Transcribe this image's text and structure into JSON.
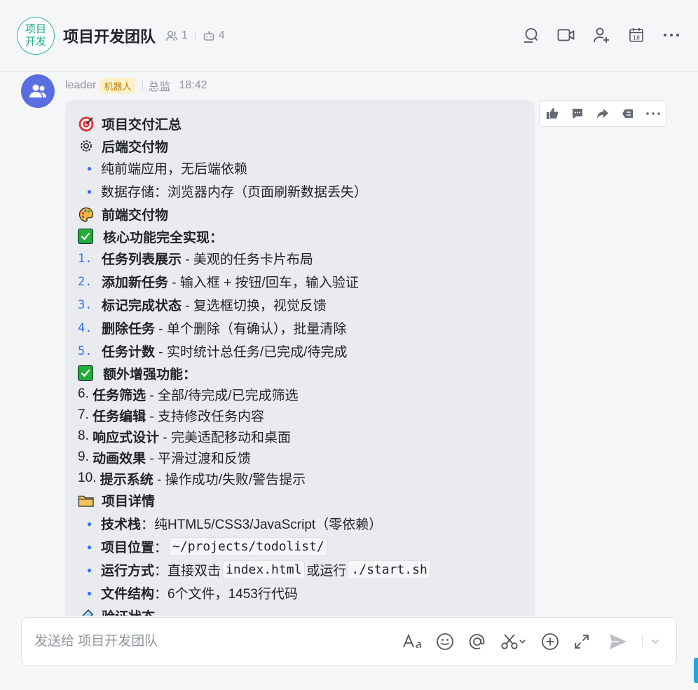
{
  "header": {
    "avatar_text": "项目开发",
    "title": "项目开发团队",
    "member_count": "1",
    "bot_count": "4"
  },
  "message": {
    "sender": "leader",
    "bot_tag": "机器人",
    "role": "总监",
    "time": "18:42",
    "lines": {
      "l1": "项目交付汇总",
      "l2": "后端交付物",
      "l3": "纯前端应用，无后端依赖",
      "l4": "数据存储：浏览器内存（页面刷新数据丢失）",
      "l5": "前端交付物",
      "l6": "核心功能完全实现：",
      "n1": "1.",
      "n1b": "任务列表展示",
      "n1t": " - 美观的任务卡片布局",
      "n2": "2.",
      "n2b": "添加新任务",
      "n2t": " - 输入框 + 按钮/回车，输入验证",
      "n3": "3.",
      "n3b": "标记完成状态",
      "n3t": " - 复选框切换，视觉反馈",
      "n4": "4.",
      "n4b": "删除任务",
      "n4t": " - 单个删除（有确认），批量清除",
      "n5": "5.",
      "n5b": "任务计数",
      "n5t": " - 实时统计总任务/已完成/待完成",
      "l7": "额外增强功能：",
      "e6": "6. ",
      "e6b": "任务筛选",
      "e6t": " - 全部/待完成/已完成筛选",
      "e7": "7. ",
      "e7b": "任务编辑",
      "e7t": " - 支持修改任务内容",
      "e8": "8. ",
      "e8b": "响应式设计",
      "e8t": " - 完美适配移动和桌面",
      "e9": "9. ",
      "e9b": "动画效果",
      "e9t": " - 平滑过渡和反馈",
      "e10": "10. ",
      "e10b": "提示系统",
      "e10t": " - 操作成功/失败/警告提示",
      "l8": "项目详情",
      "d1b": "技术栈",
      "d1t": "：纯HTML5/CSS3/JavaScript（零依赖）",
      "d2b": "项目位置",
      "d2t": "：",
      "d2c": "~/projects/todolist/",
      "d3b": "运行方式",
      "d3t": "：直接双击",
      "d3c1": "index.html",
      "d3m": "或运行",
      "d3c2": "./start.sh",
      "d4b": "文件结构",
      "d4t": "：6个文件，1453行代码",
      "l9": "验证状态"
    }
  },
  "input": {
    "placeholder": "发送给 项目开发团队"
  },
  "icons": {
    "header": [
      "search-icon",
      "video-call-icon",
      "add-member-icon",
      "calendar-icon",
      "more-icon"
    ],
    "reactions": [
      "thumbs-up-icon",
      "reply-icon",
      "forward-icon",
      "quote-icon",
      "more-icon"
    ],
    "input_tools": [
      "font-format-icon",
      "emoji-icon",
      "mention-icon",
      "screenshot-icon",
      "add-icon",
      "expand-icon",
      "send-icon"
    ]
  },
  "colors": {
    "accent": "#3370ff",
    "avatar_group_border": "#2fb69a",
    "sender_avatar": "#5b6ee1",
    "check_green": "#1fae37",
    "bot_tag_bg": "#fdf1cc"
  },
  "calendar_day": "18"
}
